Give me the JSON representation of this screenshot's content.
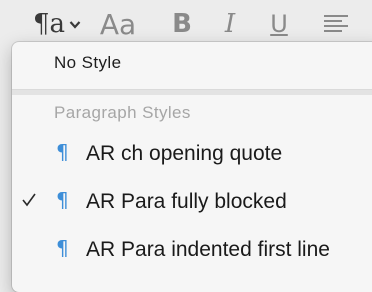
{
  "toolbar": {
    "paragraph_style_button": {
      "icon": "pilcrow-a-icon",
      "glyph": "¶a"
    },
    "character_style_button": {
      "icon": "character-style-icon",
      "glyph": "Aa"
    },
    "bold_button": {
      "glyph": "B"
    },
    "italic_button": {
      "glyph": "I"
    },
    "underline_button": {
      "glyph": "U"
    },
    "align_button": {
      "icon": "align-left-icon"
    }
  },
  "menu": {
    "no_style_label": "No Style",
    "section_header": "Paragraph Styles",
    "items": [
      {
        "label": "AR ch opening quote",
        "checked": false,
        "icon": "pilcrow-icon"
      },
      {
        "label": "AR Para fully blocked",
        "checked": true,
        "icon": "pilcrow-icon"
      },
      {
        "label": "AR Para indented first line",
        "checked": false,
        "icon": "pilcrow-icon"
      }
    ],
    "pilcrow_glyph": "¶",
    "accent_color": "#3d8ed8"
  }
}
